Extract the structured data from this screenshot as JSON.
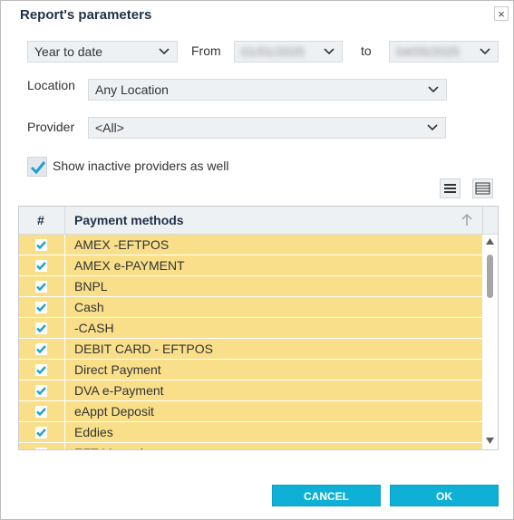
{
  "dialog": {
    "title": "Report's parameters",
    "close_label": "×"
  },
  "period": {
    "selected": "Year to date",
    "from_label": "From",
    "from_value": "01/01/2025",
    "to_label": "to",
    "to_value": "04/05/2025"
  },
  "location": {
    "label": "Location",
    "selected": "Any Location"
  },
  "provider": {
    "label": "Provider",
    "selected": "<All>"
  },
  "inactive": {
    "label": "Show inactive providers as well",
    "checked": true
  },
  "grid": {
    "col_index": "#",
    "col_methods": "Payment methods",
    "rows": [
      {
        "name": "AMEX -EFTPOS",
        "checked": true
      },
      {
        "name": "AMEX e-PAYMENT",
        "checked": true
      },
      {
        "name": "BNPL",
        "checked": true
      },
      {
        "name": "Cash",
        "checked": true
      },
      {
        "name": "-CASH",
        "checked": true
      },
      {
        "name": "DEBIT CARD - EFTPOS",
        "checked": true
      },
      {
        "name": "Direct Payment",
        "checked": true
      },
      {
        "name": "DVA e-Payment",
        "checked": true
      },
      {
        "name": "eAppt Deposit",
        "checked": true
      },
      {
        "name": "Eddies",
        "checked": true
      },
      {
        "name": "EFT Manual",
        "checked": true
      }
    ]
  },
  "buttons": {
    "cancel": "CANCEL",
    "ok": "OK"
  },
  "colors": {
    "accent": "#0fb0d6",
    "row_highlight": "#f9df8a",
    "check": "#1aa3d1"
  }
}
